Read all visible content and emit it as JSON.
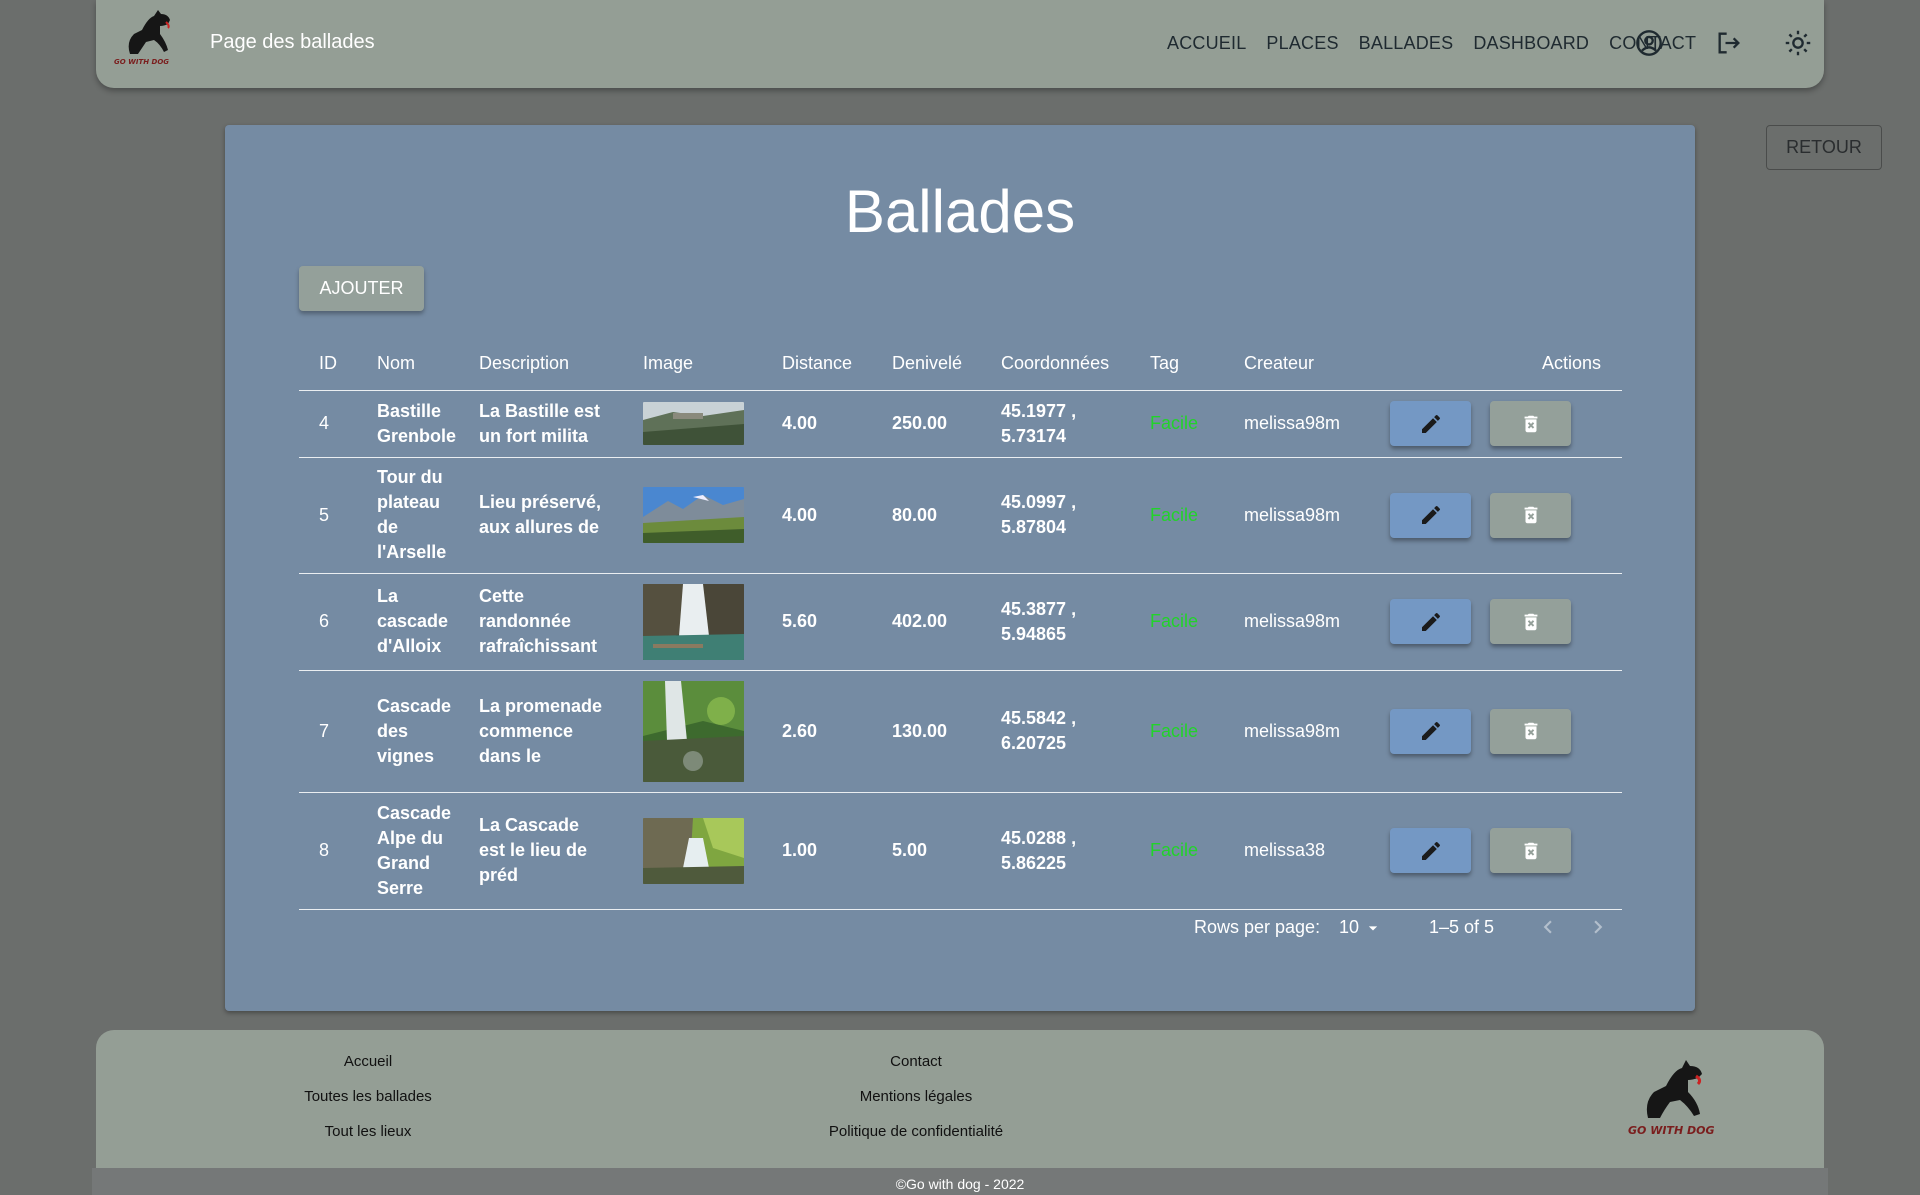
{
  "header": {
    "brand_title": "Page des ballades",
    "logo_text": "GO WITH DOG",
    "nav": [
      "ACCUEIL",
      "PLACES",
      "BALLADES",
      "DASHBOARD",
      "CONTACT"
    ]
  },
  "retour_label": "RETOUR",
  "main": {
    "title": "Ballades",
    "add_label": "AJOUTER",
    "columns": [
      "ID",
      "Nom",
      "Description",
      "Image",
      "Distance",
      "Denivelé",
      "Coordonnées",
      "Tag",
      "Createur",
      "Actions"
    ],
    "rows": [
      {
        "id": "4",
        "name": [
          "Bastille",
          "Grenbole"
        ],
        "desc": [
          "La Bastille est",
          "un fort milita"
        ],
        "distance": "4.00",
        "denivele": "250.00",
        "coords": [
          "45.1977 ,",
          "5.73174"
        ],
        "tag": "Facile",
        "creator": "melissa98m",
        "image": "fortress-hill"
      },
      {
        "id": "5",
        "name": [
          "Tour du",
          "plateau",
          "de",
          "l'Arselle"
        ],
        "desc": [
          "Lieu préservé,",
          "aux allures de"
        ],
        "distance": "4.00",
        "denivele": "80.00",
        "coords": [
          "45.0997 ,",
          "5.87804"
        ],
        "tag": "Facile",
        "creator": "melissa98m",
        "image": "mountain-meadow"
      },
      {
        "id": "6",
        "name": [
          "La",
          "cascade",
          "d'Alloix"
        ],
        "desc": [
          "Cette",
          "randonnée",
          "rafraîchissant"
        ],
        "distance": "5.60",
        "denivele": "402.00",
        "coords": [
          "45.3877 ,",
          "5.94865"
        ],
        "tag": "Facile",
        "creator": "melissa98m",
        "image": "waterfall-pool"
      },
      {
        "id": "7",
        "name": [
          "Cascade",
          "des",
          "vignes"
        ],
        "desc": [
          "La promenade",
          "commence",
          "dans le"
        ],
        "distance": "2.60",
        "denivele": "130.00",
        "coords": [
          "45.5842 ,",
          "6.20725"
        ],
        "tag": "Facile",
        "creator": "melissa98m",
        "image": "forest-waterfall"
      },
      {
        "id": "8",
        "name": [
          "Cascade",
          "Alpe du",
          "Grand",
          "Serre"
        ],
        "desc": [
          "La Cascade",
          "est le lieu de",
          "préd"
        ],
        "distance": "1.00",
        "denivele": "5.00",
        "coords": [
          "45.0288 ,",
          "5.86225"
        ],
        "tag": "Facile",
        "creator": "melissa38",
        "image": "green-cascade"
      }
    ],
    "pagination": {
      "rows_per_page_label": "Rows per page:",
      "rows_per_page": "10",
      "range": "1–5 of 5"
    }
  },
  "footer": {
    "col1": [
      "Accueil",
      "Toutes les ballades",
      "Tout les lieux"
    ],
    "col2": [
      "Contact",
      "Mentions légales",
      "Politique de confidentialité"
    ],
    "logo_text": "GO WITH DOG",
    "copyright": "©Go with dog - 2022"
  },
  "colors": {
    "navbar": "#949e95",
    "background": "#6b6e6c",
    "paper": "#758ba3",
    "edit": "#7498c4",
    "delete": "#94a09a",
    "tag": "#22d32a"
  }
}
